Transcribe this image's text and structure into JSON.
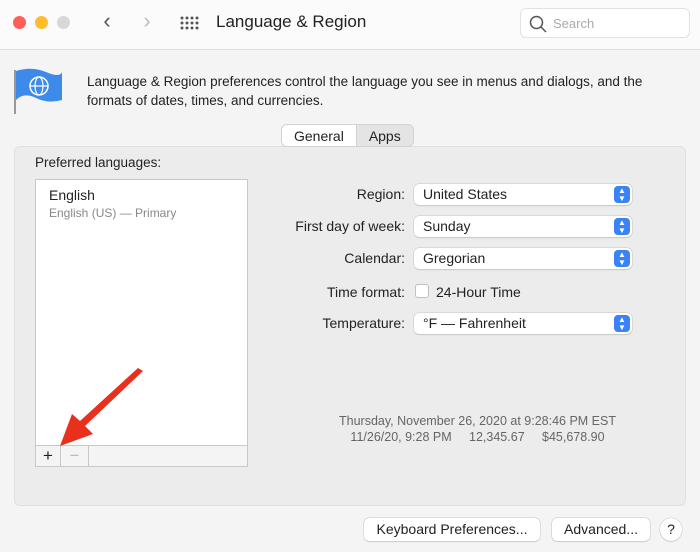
{
  "window": {
    "title": "Language & Region",
    "search_placeholder": "Search"
  },
  "description": "Language & Region preferences control the language you see in menus and dialogs, and the formats of dates, times, and currencies.",
  "tabs": [
    {
      "label": "General",
      "selected": true
    },
    {
      "label": "Apps",
      "selected": false
    }
  ],
  "languages": {
    "heading": "Preferred languages:",
    "items": [
      {
        "name": "English",
        "detail": "English (US) — Primary"
      }
    ],
    "add": "+",
    "remove": "−"
  },
  "settings": {
    "region": {
      "label": "Region:",
      "value": "United States"
    },
    "first_day": {
      "label": "First day of week:",
      "value": "Sunday"
    },
    "calendar": {
      "label": "Calendar:",
      "value": "Gregorian"
    },
    "time_format": {
      "label": "Time format:",
      "option": "24-Hour Time",
      "checked": false
    },
    "temperature": {
      "label": "Temperature:",
      "value": "°F — Fahrenheit"
    }
  },
  "summary": {
    "line1": "Thursday, November 26, 2020 at 9:28:46 PM EST",
    "date": "11/26/20, 9:28 PM",
    "number": "12,345.67",
    "currency": "$45,678.90"
  },
  "buttons": {
    "keyboard": "Keyboard Preferences...",
    "advanced": "Advanced...",
    "help": "?"
  },
  "colors": {
    "accent": "#3b82f6",
    "arrow": "#e8301c"
  }
}
